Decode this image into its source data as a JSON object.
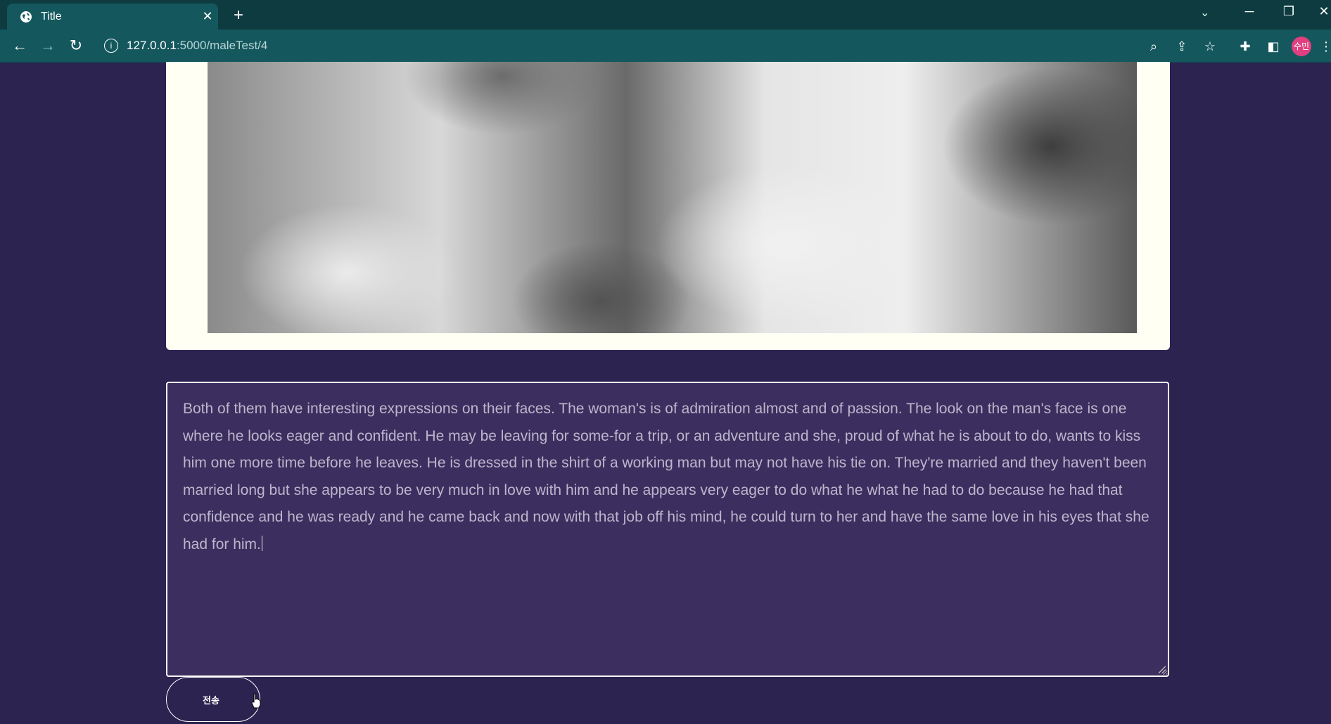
{
  "browser": {
    "tab_title": "Title",
    "tab_close": "✕",
    "new_tab": "+",
    "url_host": "127.0.0.1",
    "url_path": ":5000/maleTest/4",
    "profile_label": "수민"
  },
  "answer": {
    "text": "Both of them have interesting expressions on their faces. The woman's is of admiration almost and of passion. The look on the man's face is one where he looks eager and confident. He may be leaving for some-for a trip, or an adventure and she, proud of what he is about to do, wants to kiss him one more time before he leaves. He is dressed in the shirt of a working man but may not have his tie on. They're married and they haven't been married long but she appears to be very much in love with him and he appears very eager to do what he what he had to do because he had that confidence and he was ready and he came back and now with that job off his mind, he could turn to her and have the same love in his eyes that she had for him."
  },
  "submit": {
    "label": "전송"
  },
  "colors": {
    "page_bg": "#2c2350",
    "textarea_bg": "#3c2f5f",
    "chrome": "#14585e"
  }
}
